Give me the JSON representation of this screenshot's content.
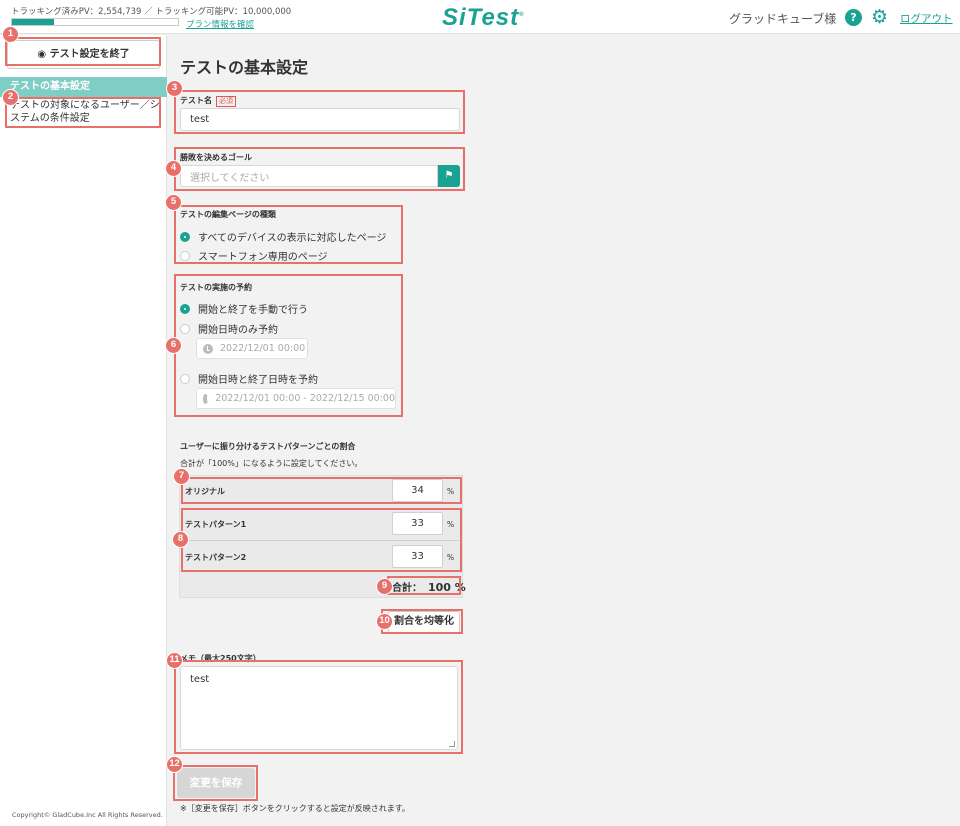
{
  "header": {
    "tracked_pv": "トラッキング済みPV：2,554,739 ／ トラッキング可能PV：10,000,000",
    "pv_progress": 0.255,
    "plan_link": "プラン情報を確認",
    "logo": "SiTest",
    "logo_mark": "®",
    "user_name": "グラッドキューブ様",
    "help_glyph": "?",
    "gear_glyph": "⚙",
    "logout": "ログアウト"
  },
  "sidebar": {
    "end_button": "◉ テスト設定を終了",
    "items": [
      {
        "label": "テストの基本設定",
        "active": true
      },
      {
        "label": "テストの対象になるユーザー／システムの条件設定",
        "active": false
      }
    ],
    "copyright": "Copyright© GladCube.Inc All Rights Reserved."
  },
  "main": {
    "page_title": "テストの基本設定",
    "test_name": {
      "label": "テスト名",
      "required": "必須",
      "value": "test"
    },
    "goal": {
      "label": "勝敗を決めるゴール",
      "placeholder": "選択してください",
      "btn_glyph": "⚑"
    },
    "page_type": {
      "label": "テストの編集ページの種類",
      "options": [
        {
          "label": "すべてのデバイスの表示に対応したページ",
          "selected": true
        },
        {
          "label": "スマートフォン専用のページ",
          "selected": false
        }
      ]
    },
    "schedule": {
      "label": "テストの実施の予約",
      "options": [
        {
          "label": "開始と終了を手動で行う",
          "selected": true
        },
        {
          "label": "開始日時のみ予約",
          "selected": false
        },
        {
          "label": "開始日時と終了日時を予約",
          "selected": false
        }
      ],
      "start_only_value": "2022/12/01 00:00",
      "range_value": "2022/12/01 00:00 - 2022/12/15 00:00"
    },
    "ratio": {
      "label": "ユーザーに振り分けるテストパターンごとの割合",
      "note": "合計が「100%」になるように設定してください。",
      "rows": [
        {
          "name": "オリジナル",
          "value": "34"
        },
        {
          "name": "テストパターン1",
          "value": "33"
        },
        {
          "name": "テストパターン2",
          "value": "33"
        }
      ],
      "unit": "%",
      "total_label": "合計：",
      "total_value": "100 %",
      "equalize_button": "割合を均等化"
    },
    "memo": {
      "label": "メモ（最大250文字）",
      "value": "test"
    },
    "save_button": "変更を保存",
    "save_note": "※［変更を保存］ボタンをクリックすると設定が反映されます。"
  },
  "badges": [
    "1",
    "2",
    "3",
    "4",
    "5",
    "6",
    "7",
    "8",
    "9",
    "10",
    "11",
    "12"
  ],
  "colors": {
    "accent": "#1aa393",
    "sidebar_active": "#7ecec5",
    "annotation": "#e8706a"
  }
}
